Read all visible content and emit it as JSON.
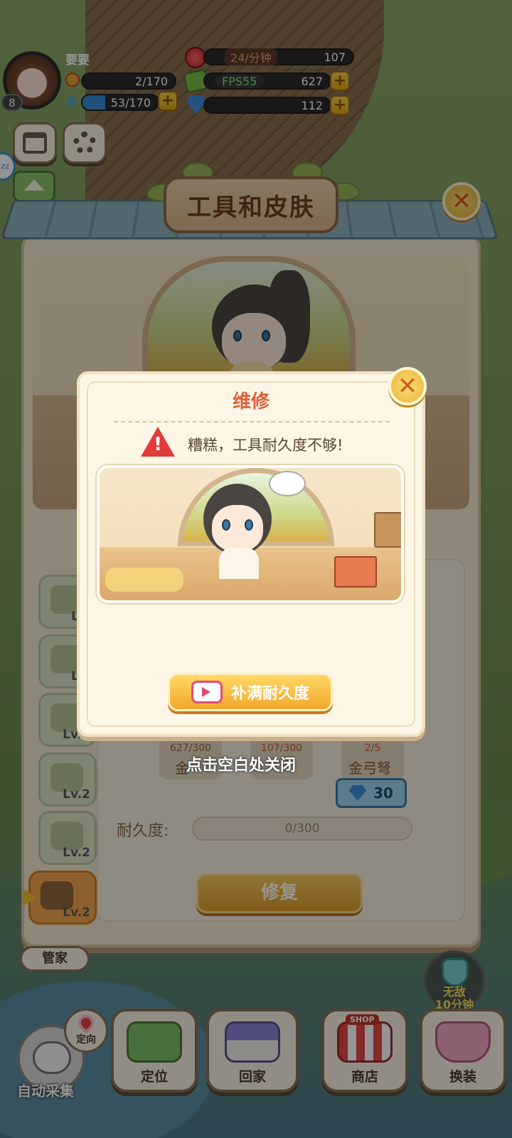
{
  "player": {
    "name": "要要",
    "level": "8",
    "exp": "2/170",
    "energy": "53/170"
  },
  "resources": {
    "hearts_rate": "24/分钟",
    "hearts": "107",
    "fps_label": "FPS55",
    "money": "627",
    "diamonds": "112"
  },
  "side": {
    "zz": "zz"
  },
  "panel": {
    "title": "工具和皮肤",
    "tools": [
      "Lv.",
      "Lv.",
      "Lv.2",
      "Lv.2",
      "Lv.2",
      "Lv.2"
    ]
  },
  "materials": [
    {
      "count": "627/300",
      "name": "金"
    },
    {
      "count": "107/300",
      "name": ""
    },
    {
      "count": "2/5",
      "name": "金弓弩"
    }
  ],
  "cost": {
    "diamonds": "30"
  },
  "durability": {
    "label": "耐久度:",
    "value": "0/300"
  },
  "repair_button": "修复",
  "dismiss_hint": "点击空白处关闭",
  "popup": {
    "title": "维修",
    "warning": "糟糕，工具耐久度不够!",
    "refill_button": "补满耐久度"
  },
  "bottom": {
    "steward": "管家",
    "invincible": "无敌",
    "invincible_time": "10分钟",
    "orient": "定向",
    "auto_collect": "自动采集",
    "locate": "定位",
    "home": "回家",
    "shop": "商店",
    "shop_sign": "SHOP",
    "dress": "换装"
  }
}
